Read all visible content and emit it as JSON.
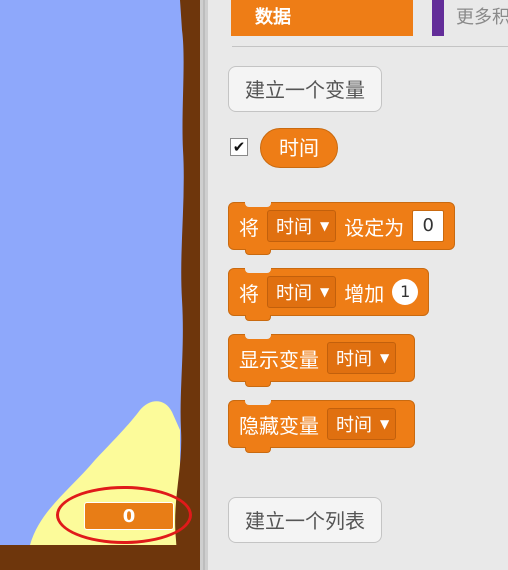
{
  "stage": {
    "variable_monitor_value": "0",
    "colors": {
      "sky": "#8ea8fb",
      "ground": "#6e360c",
      "sand": "#fcfb9a",
      "annotation": "#e01a1a"
    }
  },
  "palette": {
    "categories": {
      "data_label": "数据",
      "more_label": "更多积"
    },
    "make_variable_label": "建立一个变量",
    "variable": {
      "checked_glyph": "✔",
      "name": "时间"
    },
    "blocks": {
      "set": {
        "prefix": "将",
        "var": "时间",
        "caret": "▼",
        "middle": "设定为",
        "value": "0"
      },
      "change": {
        "prefix": "将",
        "var": "时间",
        "caret": "▼",
        "middle": "增加",
        "value": "1"
      },
      "show": {
        "prefix": "显示变量",
        "var": "时间",
        "caret": "▼"
      },
      "hide": {
        "prefix": "隐藏变量",
        "var": "时间",
        "caret": "▼"
      }
    },
    "make_list_label": "建立一个列表",
    "colors": {
      "data_orange": "#ee7d16",
      "more_purple": "#632d99"
    }
  }
}
